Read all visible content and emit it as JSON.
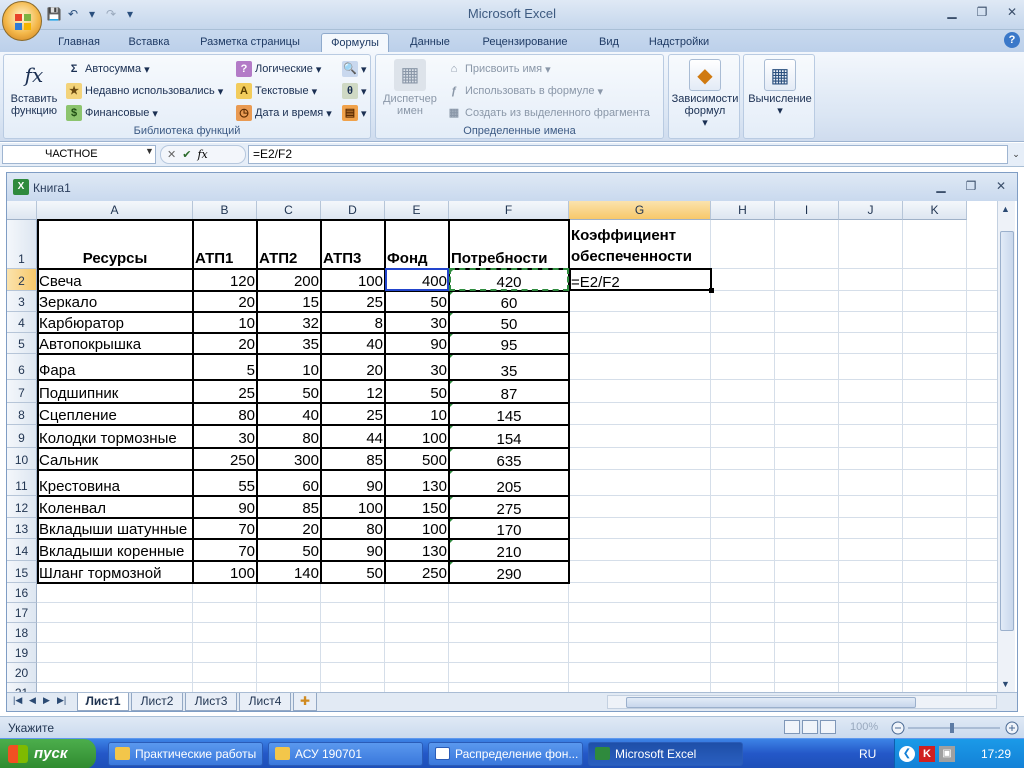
{
  "window": {
    "title": "Microsoft Excel",
    "office_logo": "office-logo",
    "minimize": "▁",
    "restore": "❐",
    "close": "✕"
  },
  "qat": {
    "save": "💾",
    "undo": "↶",
    "redo": "↷",
    "dropdown": "▾"
  },
  "tabs": [
    "Главная",
    "Вставка",
    "Разметка страницы",
    "Формулы",
    "Данные",
    "Рецензирование",
    "Вид",
    "Надстройки"
  ],
  "active_tab": "Формулы",
  "ribbon": {
    "insert_function": "Вставить функцию",
    "autosum": "Автосумма",
    "recent": "Недавно использовались",
    "financial": "Финансовые",
    "logical": "Логические",
    "text": "Текстовые",
    "datetime": "Дата и время",
    "group_library": "Библиотека функций",
    "name_manager": "Диспетчер имен",
    "define_name": "Присвоить имя",
    "use_in_formula": "Использовать в формуле",
    "create_from_selection": "Создать из выделенного фрагмента",
    "group_names": "Определенные имена",
    "dependencies": "Зависимости формул",
    "calculation": "Вычисление"
  },
  "formula_bar": {
    "name_box": "ЧАСТНОЕ",
    "cancel": "✕",
    "enter": "✔",
    "fx": "fx",
    "formula": "=E2/F2"
  },
  "workbook": {
    "title": "Книга1",
    "minimize": "▁",
    "restore": "❐",
    "close": "✕"
  },
  "columns": [
    "A",
    "B",
    "C",
    "D",
    "E",
    "F",
    "G",
    "H",
    "I",
    "J",
    "K"
  ],
  "header_row": [
    "Ресурсы",
    "АТП1",
    "АТП2",
    "АТП3",
    "Фонд",
    "Потребности",
    "Коэффициент",
    "обеспеченности"
  ],
  "rows": [
    [
      "Свеча",
      "120",
      "200",
      "100",
      "400",
      "420"
    ],
    [
      "Зеркало",
      "20",
      "15",
      "25",
      "50",
      "60"
    ],
    [
      "Карбюратор",
      "10",
      "32",
      "8",
      "30",
      "50"
    ],
    [
      "Автопокрышка",
      "20",
      "35",
      "40",
      "90",
      "95"
    ],
    [
      "Фара",
      "5",
      "10",
      "20",
      "30",
      "35"
    ],
    [
      "Подшипник",
      "25",
      "50",
      "12",
      "50",
      "87"
    ],
    [
      "Сцепление",
      "80",
      "40",
      "25",
      "10",
      "145"
    ],
    [
      "Колодки тормозные",
      "30",
      "80",
      "44",
      "100",
      "154"
    ],
    [
      "Сальник",
      "250",
      "300",
      "85",
      "500",
      "635"
    ],
    [
      "Крестовина",
      "55",
      "60",
      "90",
      "130",
      "205"
    ],
    [
      "Коленвал",
      "90",
      "85",
      "100",
      "150",
      "275"
    ],
    [
      "Вкладыши шатунные",
      "70",
      "20",
      "80",
      "100",
      "170"
    ],
    [
      "Вкладыши коренные",
      "70",
      "50",
      "90",
      "130",
      "210"
    ],
    [
      "Шланг тормозной",
      "100",
      "140",
      "50",
      "250",
      "290"
    ]
  ],
  "edit_cell": "=E2/F2",
  "row_numbers": [
    "1",
    "2",
    "3",
    "4",
    "5",
    "6",
    "7",
    "8",
    "9",
    "10",
    "11",
    "12",
    "13",
    "14",
    "15",
    "16",
    "17",
    "18",
    "19",
    "20",
    "21"
  ],
  "sheets": [
    "Лист1",
    "Лист2",
    "Лист3",
    "Лист4"
  ],
  "active_sheet": "Лист1",
  "status": {
    "mode": "Укажите",
    "zoom": "100%"
  },
  "taskbar": {
    "start": "пуск",
    "items": [
      "Практические работы",
      "АСУ 190701",
      "Распределение фон...",
      "Microsoft Excel"
    ],
    "lang": "RU",
    "time": "17:29"
  },
  "colors": {
    "accent": "#2458c8",
    "selected_header": "#f7c86a",
    "border": "#000000"
  }
}
